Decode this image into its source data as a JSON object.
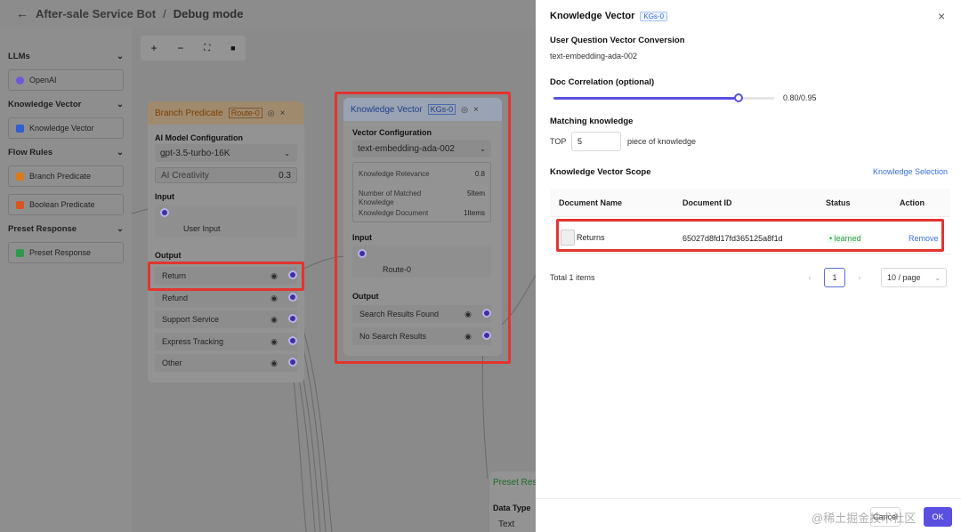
{
  "header": {
    "back_icon": "arrow-left-icon",
    "breadcrumb_app": "After-sale Service Bot",
    "separator": "/",
    "breadcrumb_page": "Debug mode"
  },
  "sidebar": {
    "sections": [
      {
        "title": "LLMs",
        "items": [
          {
            "label": "OpenAI",
            "icon": "openai-icon",
            "color": "#6b5bd6"
          }
        ]
      },
      {
        "title": "Knowledge Vector",
        "items": [
          {
            "label": "Knowledge Vector",
            "icon": "book-icon",
            "color": "#2f5fd0"
          }
        ]
      },
      {
        "title": "Flow Rules",
        "items": [
          {
            "label": "Branch Predicate",
            "icon": "branch-icon",
            "color": "#d97a1e"
          },
          {
            "label": "Boolean Predicate",
            "icon": "boolean-icon",
            "color": "#d9541e"
          }
        ]
      },
      {
        "title": "Preset Response",
        "items": [
          {
            "label": "Preset Response",
            "icon": "response-icon",
            "color": "#2f9a4a"
          }
        ]
      }
    ]
  },
  "toolbar": {
    "zoom_in": "+",
    "zoom_out": "−",
    "fit": "⛶",
    "lock": "🔒"
  },
  "branch_node": {
    "title": "Branch Predicate",
    "tag": "Route-0",
    "model_config_label": "AI Model Configuration",
    "model": "gpt-3.5-turbo-16K",
    "creativity_label": "AI Creativity",
    "creativity_value": "0.3",
    "input_label": "Input",
    "input_item": "User Input",
    "output_label": "Output",
    "outputs": [
      "Return",
      "Refund",
      "Support Service",
      "Express Tracking",
      "Other"
    ]
  },
  "kv_node": {
    "title": "Knowledge Vector",
    "tag": "KGs-0",
    "vector_config_label": "Vector Configuration",
    "model": "text-embedding-ada-002",
    "relevance_label": "Knowledge Relevance",
    "relevance_value": "0.8",
    "matched_label_1": "Number of Matched",
    "matched_label_2": "Knowledge",
    "matched_value": "5Item",
    "document_label": "Knowledge Document",
    "document_value": "1Items",
    "input_label": "Input",
    "input_item": "Route-0",
    "output_label": "Output",
    "outputs": [
      "Search Results Found",
      "No Search Results"
    ]
  },
  "preset_node": {
    "title": "Preset Res",
    "data_type_label": "Data Type",
    "data_type_value": "Text"
  },
  "panel": {
    "title": "Knowledge Vector",
    "tag": "KGs-0",
    "close": "×",
    "conversion_label": "User Question Vector Conversion",
    "conversion_value": "text-embedding-ada-002",
    "doc_corr_label": "Doc Correlation (optional)",
    "doc_corr_value": "0.80/0.95",
    "doc_corr_fraction": 0.84,
    "matching_label": "Matching knowledge",
    "top_label": "TOP",
    "top_value": "5",
    "top_suffix": "piece of knowledge",
    "scope_label": "Knowledge Vector Scope",
    "selection_link": "Knowledge Selection",
    "table": {
      "headers": [
        "Document Name",
        "Document ID",
        "Status",
        "Action"
      ],
      "rows": [
        {
          "name": "Returns",
          "id": "65027d8fd17fd365125a8f1d",
          "status": "learned",
          "action": "Remove"
        }
      ]
    },
    "total": "Total 1 items",
    "page": "1",
    "page_size": "10 / page",
    "cancel": "Cancel",
    "ok": "OK"
  },
  "watermark": "@稀土掘金技术社区",
  "colors": {
    "accent": "#5b4fe0",
    "highlight": "#e3342f",
    "link": "#3b6fd8",
    "learned": "#2f9a4a"
  }
}
